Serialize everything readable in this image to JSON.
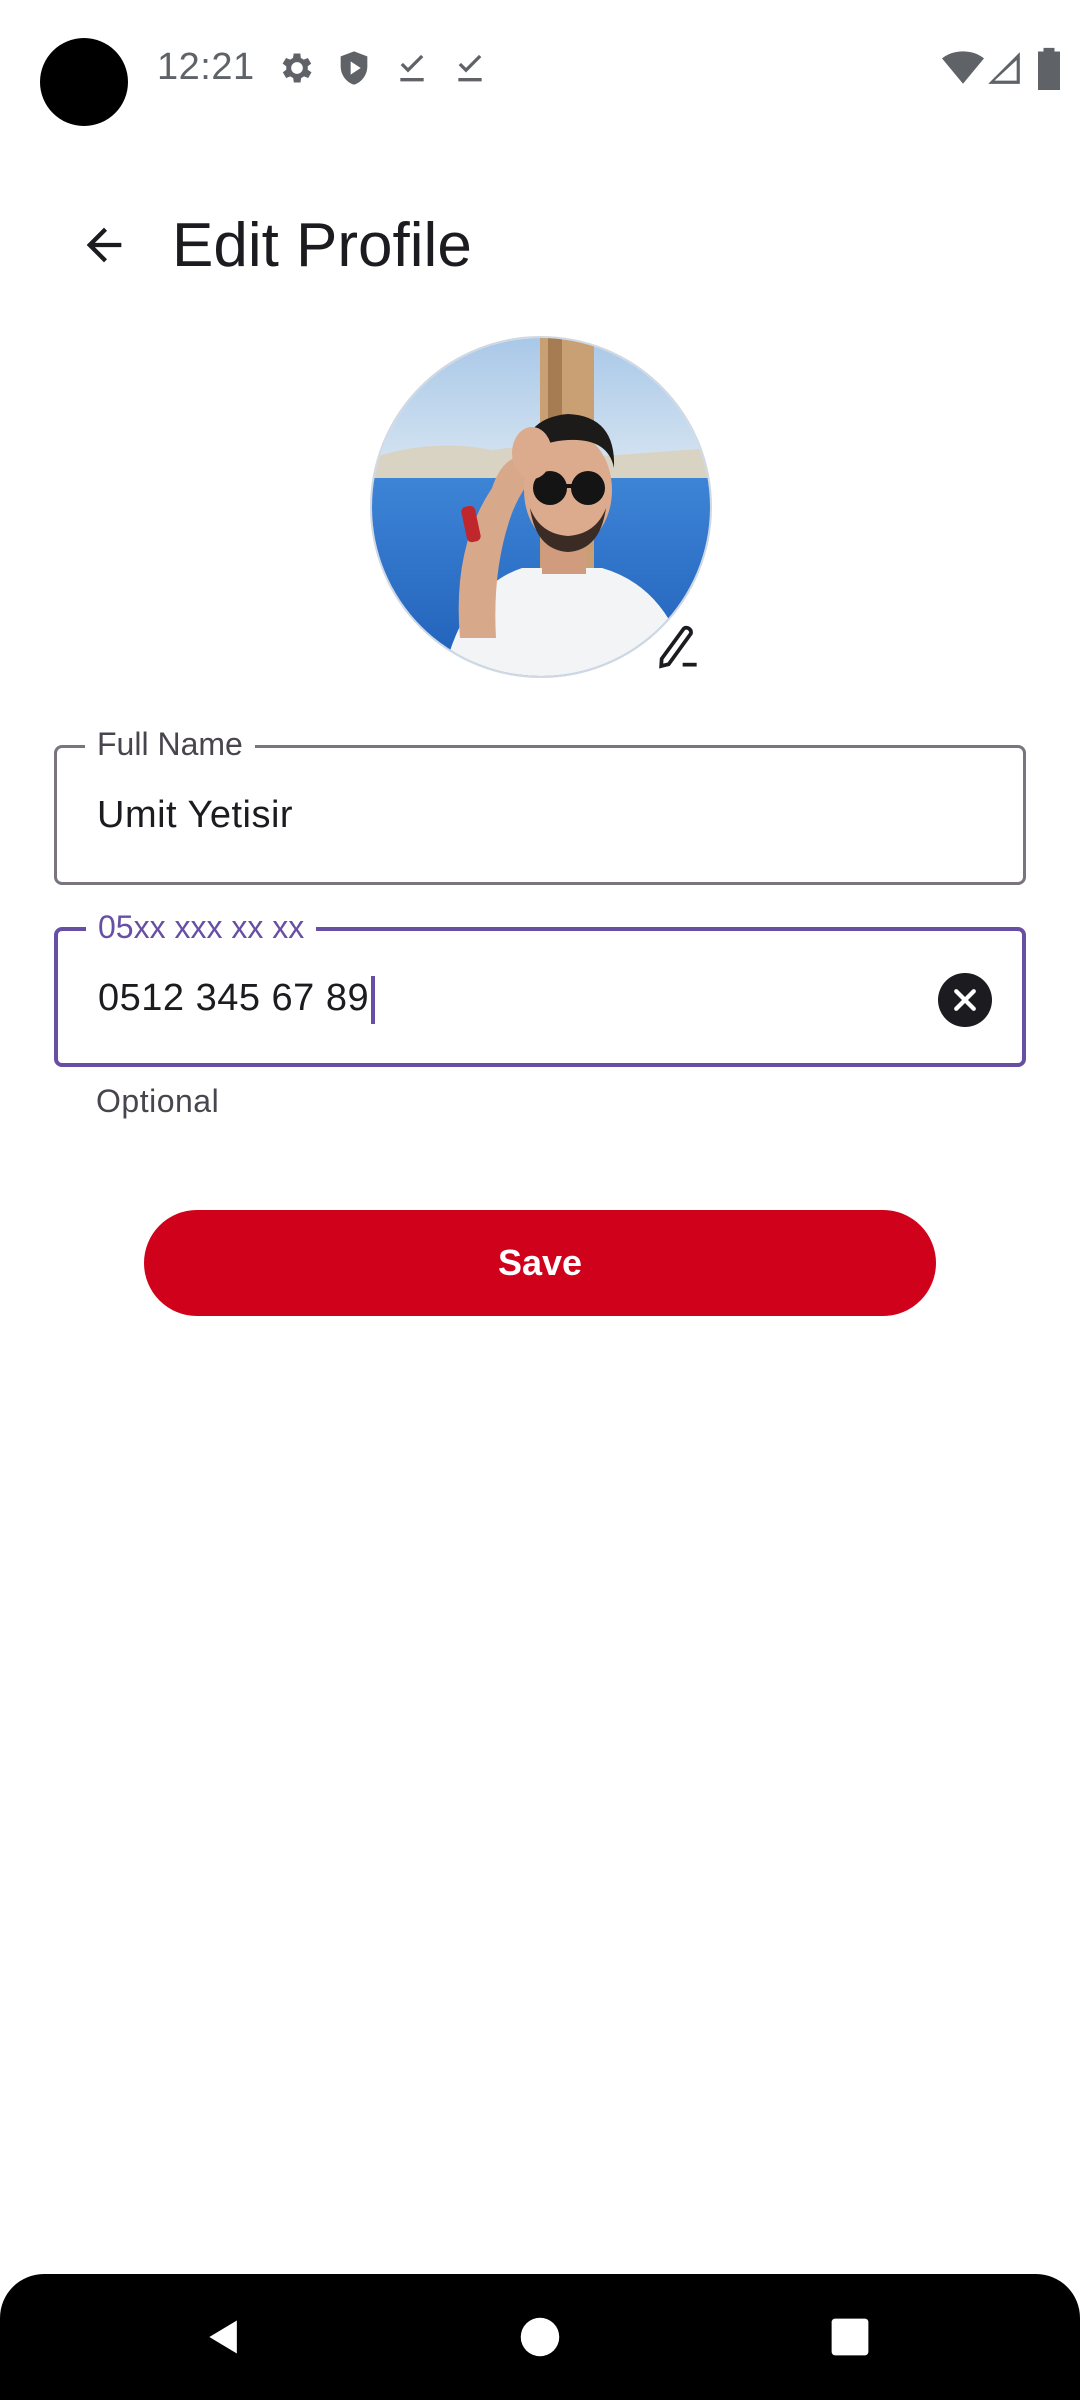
{
  "status_bar": {
    "time": "12:21",
    "left_icons": [
      "gear-icon",
      "shield-icon",
      "download-done-icon",
      "download-done-icon"
    ],
    "right_icons": [
      "wifi-icon",
      "signal-icon",
      "battery-icon"
    ]
  },
  "app_bar": {
    "title": "Edit Profile",
    "back_icon": "arrow-back-icon"
  },
  "avatar": {
    "edit_icon": "edit-pencil-icon"
  },
  "form": {
    "full_name": {
      "label": "Full Name",
      "value": "Umit Yetisir"
    },
    "phone": {
      "label": "05xx xxx xx xx",
      "value": "0512 345 67 89",
      "helper": "Optional",
      "clear_icon": "clear-icon"
    },
    "save_label": "Save"
  },
  "colors": {
    "accent": "#6750a4",
    "save_button": "#d0021b",
    "text": "#1c1b1f",
    "outline": "#79747e"
  },
  "nav_bar": {
    "icons": [
      "nav-back-icon",
      "nav-home-icon",
      "nav-recents-icon"
    ]
  }
}
